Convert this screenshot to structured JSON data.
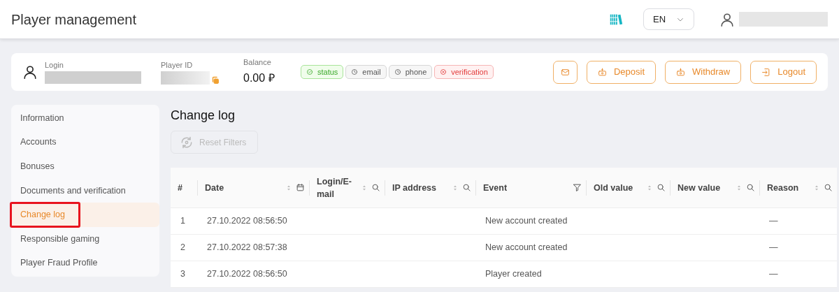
{
  "header": {
    "title": "Player management",
    "language": "EN"
  },
  "player": {
    "login_label": "Login",
    "id_label": "Player ID",
    "balance_label": "Balance",
    "balance": "0.00 ₽",
    "badges": [
      {
        "label": "status",
        "kind": "ok"
      },
      {
        "label": "email",
        "kind": "pending"
      },
      {
        "label": "phone",
        "kind": "pending"
      },
      {
        "label": "verification",
        "kind": "error"
      }
    ],
    "buttons": [
      {
        "kind": "mail"
      },
      {
        "label": "Deposit",
        "kind": "money"
      },
      {
        "label": "Withdraw",
        "kind": "money"
      },
      {
        "label": "Logout",
        "kind": "logout"
      }
    ]
  },
  "sidebar": {
    "items": [
      {
        "label": "Information",
        "selected": false,
        "highlighted": false
      },
      {
        "label": "Accounts",
        "selected": false,
        "highlighted": false
      },
      {
        "label": "Bonuses",
        "selected": false,
        "highlighted": false
      },
      {
        "label": "Documents and verification",
        "selected": false,
        "highlighted": false
      },
      {
        "label": "Change log",
        "selected": true,
        "highlighted": true
      },
      {
        "label": "Responsible gaming",
        "selected": false,
        "highlighted": false
      },
      {
        "label": "Player Fraud Profile",
        "selected": false,
        "highlighted": false
      }
    ]
  },
  "content": {
    "title": "Change log",
    "reset_button": {
      "label": "Reset Filters",
      "disabled": true
    }
  },
  "table": {
    "columns": [
      {
        "label": "#",
        "sortable": false,
        "kind": "plain"
      },
      {
        "label": "Date",
        "sortable": true,
        "kind": "calendar"
      },
      {
        "label": "Login/E-mail",
        "sortable": true,
        "kind": "search"
      },
      {
        "label": "IP address",
        "sortable": true,
        "kind": "search"
      },
      {
        "label": "Event",
        "sortable": false,
        "kind": "filter"
      },
      {
        "label": "Old value",
        "sortable": true,
        "kind": "search"
      },
      {
        "label": "New value",
        "sortable": true,
        "kind": "search"
      },
      {
        "label": "Reason",
        "sortable": true,
        "kind": "search"
      }
    ],
    "rows": [
      [
        "1",
        "27.10.2022 08:56:50",
        "",
        "",
        "New account created",
        "",
        "",
        "—"
      ],
      [
        "2",
        "27.10.2022 08:57:38",
        "",
        "",
        "New account created",
        "",
        "",
        "—"
      ],
      [
        "3",
        "27.10.2022 08:56:50",
        "",
        "",
        "Player created",
        "",
        "",
        "—"
      ]
    ]
  }
}
